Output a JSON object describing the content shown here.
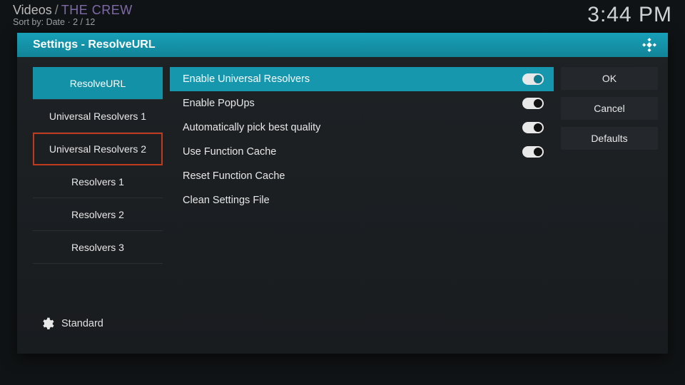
{
  "breadcrumb": {
    "section": "Videos",
    "current": "THE CREW"
  },
  "subinfo": {
    "sort_label": "Sort by:",
    "sort_value": "Date",
    "pos": "2 / 12"
  },
  "clock": "3:44 PM",
  "dialog": {
    "title": "Settings - ResolveURL"
  },
  "sidebar": {
    "items": [
      {
        "label": "ResolveURL",
        "active": true,
        "marker": false
      },
      {
        "label": "Universal Resolvers 1",
        "active": false,
        "marker": false
      },
      {
        "label": "Universal Resolvers 2",
        "active": false,
        "marker": true
      },
      {
        "label": "Resolvers 1",
        "active": false,
        "marker": false
      },
      {
        "label": "Resolvers 2",
        "active": false,
        "marker": false
      },
      {
        "label": "Resolvers 3",
        "active": false,
        "marker": false
      }
    ],
    "level_label": "Standard"
  },
  "settings": [
    {
      "label": "Enable Universal Resolvers",
      "type": "toggle",
      "on": true,
      "highlighted": true
    },
    {
      "label": "Enable PopUps",
      "type": "toggle",
      "on": true,
      "highlighted": false
    },
    {
      "label": "Automatically pick best quality",
      "type": "toggle",
      "on": true,
      "highlighted": false
    },
    {
      "label": "Use Function Cache",
      "type": "toggle",
      "on": true,
      "highlighted": false
    },
    {
      "label": "Reset Function Cache",
      "type": "action",
      "highlighted": false
    },
    {
      "label": "Clean Settings File",
      "type": "action",
      "highlighted": false
    }
  ],
  "actions": {
    "ok": "OK",
    "cancel": "Cancel",
    "defaults": "Defaults"
  }
}
